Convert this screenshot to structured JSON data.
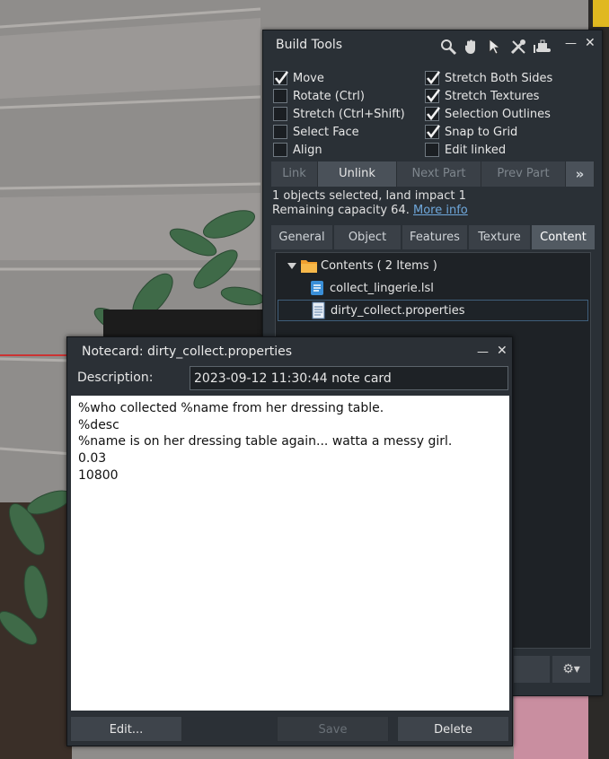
{
  "build_tools": {
    "title": "Build Tools",
    "tool_icons": [
      "zoom-tool-icon",
      "grab-hand-icon",
      "pointer-edit-icon",
      "create-tools-icon",
      "land-bulldozer-icon"
    ],
    "minimize_glyph": "—",
    "close_glyph": "✕",
    "options_left": [
      {
        "label": "Move",
        "checked": true
      },
      {
        "label": "Rotate (Ctrl)",
        "checked": false
      },
      {
        "label": "Stretch (Ctrl+Shift)",
        "checked": false
      },
      {
        "label": "Select Face",
        "checked": false
      },
      {
        "label": "Align",
        "checked": false
      }
    ],
    "options_right": [
      {
        "label": "Stretch Both Sides",
        "checked": true
      },
      {
        "label": "Stretch Textures",
        "checked": true
      },
      {
        "label": "Selection Outlines",
        "checked": true
      },
      {
        "label": "Snap to Grid",
        "checked": true
      },
      {
        "label": "Edit linked",
        "checked": false
      }
    ],
    "link_buttons": {
      "link": "Link",
      "unlink": "Unlink",
      "next_part": "Next Part",
      "prev_part": "Prev Part",
      "more": "»"
    },
    "selection_info": "1 objects selected, land impact 1",
    "remaining_capacity": "Remaining capacity 64.",
    "more_info_link": "More info",
    "tabs": [
      "General",
      "Object",
      "Features",
      "Texture",
      "Content"
    ],
    "active_tab": "Content",
    "contents_root": "Contents ( 2 Items )",
    "items": [
      {
        "name": "collect_lingerie.lsl",
        "icon": "script-icon"
      },
      {
        "name": "dirty_collect.properties",
        "icon": "notecard-icon"
      }
    ],
    "gear_glyph": "⚙▾"
  },
  "notecard": {
    "title": "Notecard: dirty_collect.properties",
    "minimize_glyph": "—",
    "close_glyph": "✕",
    "description_label": "Description:",
    "description_value": "2023-09-12 11:30:44 note card",
    "lines": [
      "%who collected %name from her dressing table.",
      "%desc",
      "%name is on her dressing table again... watta a messy girl.",
      "0.03",
      "10800"
    ],
    "buttons": {
      "edit": "Edit...",
      "save": "Save",
      "delete": "Delete"
    }
  },
  "colors": {
    "panel_bg": "#2a3036",
    "accent_link": "#6fa8dc",
    "selection_border": "#3f5e7a",
    "folder": "#f0a030"
  }
}
